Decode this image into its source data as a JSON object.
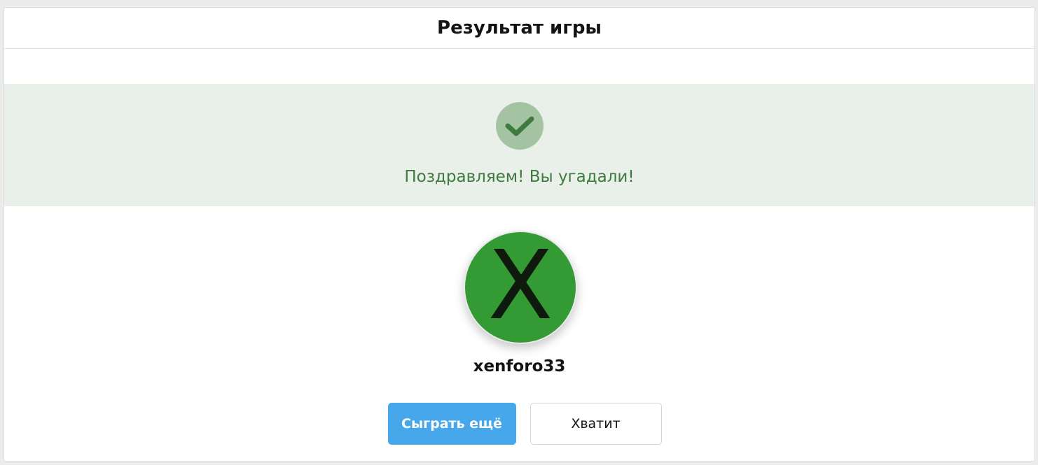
{
  "dialog": {
    "title": "Результат игры"
  },
  "result": {
    "icon": "check-icon",
    "message": "Поздравляем! Вы угадали!",
    "colors": {
      "banner_bg": "#e9f0e9",
      "icon_circle": "#a3c3a3",
      "check": "#3f7a3f",
      "message": "#3f7a3f"
    }
  },
  "user": {
    "avatar_letter": "X",
    "avatar_color": "#349a34",
    "name": "xenforo33"
  },
  "actions": {
    "play_again_label": "Сыграть ещё",
    "enough_label": "Хватит",
    "primary_color": "#47a7eb"
  }
}
